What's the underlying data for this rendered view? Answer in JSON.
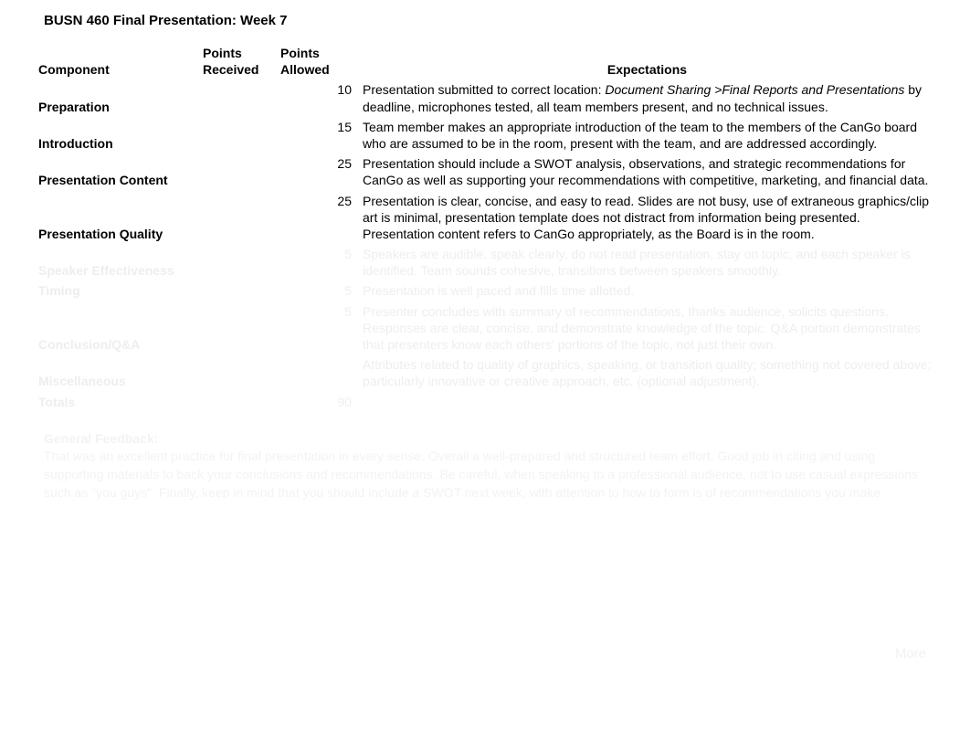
{
  "title": "BUSN 460 Final Presentation:  Week 7",
  "headers": {
    "component": "Component",
    "received": "Points Received",
    "allowed": "Points Allowed",
    "expectations": "Expectations"
  },
  "rows": [
    {
      "component": "Preparation",
      "received": "",
      "allowed": "10",
      "expect_pre": "Presentation submitted to correct location: ",
      "expect_italic": "Document Sharing >Final Reports and Presentations",
      "expect_post": " by deadline, microphones tested, all team members present, and no technical issues."
    },
    {
      "component": "Introduction",
      "received": "",
      "allowed": "15",
      "expect_pre": "Team member makes an appropriate introduction of the team to the members of the CanGo board who are assumed to be in the room, present with the team, and are addressed accordingly.",
      "expect_italic": "",
      "expect_post": ""
    },
    {
      "component": "Presentation Content",
      "received": "",
      "allowed": "25",
      "expect_pre": "Presentation should include a SWOT analysis, observations, and strategic recommendations for CanGo as well as supporting your recommendations with competitive, marketing, and financial data.",
      "expect_italic": "",
      "expect_post": ""
    },
    {
      "component": "Presentation Quality",
      "received": "",
      "allowed": "25",
      "expect_pre": "Presentation is clear, concise, and easy to read.  Slides are not busy, use of extraneous graphics/clip art is minimal, presentation template does not distract from information being presented.  Presentation content refers to CanGo appropriately, as the Board is in the room.",
      "expect_italic": "",
      "expect_post": ""
    }
  ],
  "faded_rows": [
    {
      "component": "Speaker Effectiveness",
      "received": "",
      "allowed": "5",
      "expect": "Speakers are audible, speak clearly, do not read presentation, stay on topic, and each speaker is identified. Team sounds cohesive, transitions between speakers smoothly."
    },
    {
      "component": "Timing",
      "received": "",
      "allowed": "5",
      "expect": "Presentation is well paced and fills time allotted."
    },
    {
      "component": "Conclusion/Q&A",
      "received": "",
      "allowed": "5",
      "expect": "Presenter concludes with summary of recommendations, thanks audience, solicits questions. Responses are clear, concise, and demonstrate knowledge of the topic. Q&A portion demonstrates that presenters know each others' portions of the topic, not just their own."
    },
    {
      "component": "Miscellaneous",
      "received": "",
      "allowed": "",
      "expect": "Attributes related to quality of graphics, speaking, or transition quality; something not covered above; particularly innovative or creative approach, etc. (optional adjustment)."
    },
    {
      "component": "Totals",
      "received": "",
      "allowed": "90",
      "expect": ""
    }
  ],
  "footer": {
    "heading": "General Feedback:",
    "text": "That was an excellent practice for final presentation in every sense. Overall a well-prepared and structured team effort. Good job in citing and using supporting materials to back your conclusions and recommendations. Be careful, when speaking to a professional audience, not to use casual expressions such as \"you guys\". Finally, keep in mind that you should include a SWOT next week, with attention to how to form is of recommendations you make.",
    "more": "More"
  }
}
